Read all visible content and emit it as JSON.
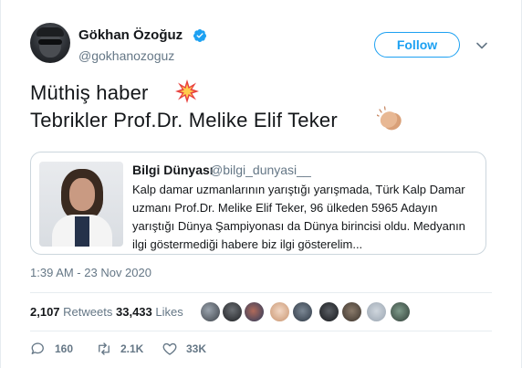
{
  "author": {
    "name": "Gökhan Özoğuz",
    "handle": "@gokhanozoguz",
    "verified_icon": "verified-badge"
  },
  "header": {
    "follow_label": "Follow",
    "menu_icon": "chevron-down"
  },
  "tweet": {
    "line1": "Müthiş  haber",
    "line1_emoji": "collision",
    "line2": "Tebrikler Prof.Dr. Melike Elif Teker",
    "line2_emoji": "clapping-hands"
  },
  "quote": {
    "name": "Bilgi Dünyası",
    "handle": "@bilgi_dunyasi__",
    "text": "Kalp damar uzmanlarının yarıştığı yarışmada, Türk Kalp Damar uzmanı Prof.Dr. Melike Elif Teker, 96 ülkeden 5965 Adayın yarıştığı Dünya Şampiyonası da Dünya birincisi oldu. Medyanın ilgi göstermediği habere biz ilgi gösterelim..."
  },
  "timestamp": "1:39 AM - 23 Nov 2020",
  "stats": {
    "retweets_count": "2,107",
    "retweets_label": "Retweets",
    "likes_count": "33,433",
    "likes_label": "Likes"
  },
  "actions": {
    "reply_count": "160",
    "retweet_count": "2.1K",
    "like_count": "33K"
  },
  "colors": {
    "accent": "#1da1f2",
    "text": "#14171a",
    "muted": "#657786",
    "border": "#e6ecf0"
  }
}
